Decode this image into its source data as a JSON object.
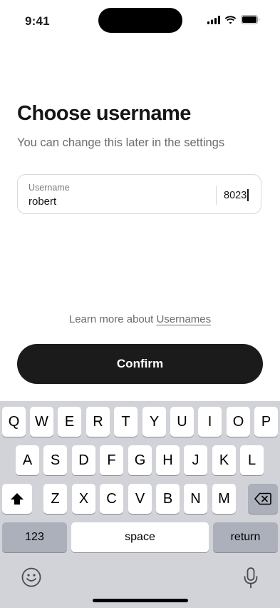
{
  "status_bar": {
    "time": "9:41",
    "icons": [
      "cellular-signal-icon",
      "wifi-icon",
      "battery-icon"
    ]
  },
  "page": {
    "title": "Choose username",
    "subtitle": "You can change this later in the settings"
  },
  "username_field": {
    "label": "Username",
    "value": "robert",
    "suffix": "8023"
  },
  "learn_more": {
    "prefix": "Learn more about ",
    "link": "Usernames"
  },
  "confirm_label": "Confirm",
  "keyboard": {
    "row1": [
      "Q",
      "W",
      "E",
      "R",
      "T",
      "Y",
      "U",
      "I",
      "O",
      "P"
    ],
    "row2": [
      "A",
      "S",
      "D",
      "F",
      "G",
      "H",
      "J",
      "K",
      "L"
    ],
    "row3": [
      "Z",
      "X",
      "C",
      "V",
      "B",
      "N",
      "M"
    ],
    "numbers_label": "123",
    "space_label": "space",
    "return_label": "return",
    "icons": [
      "shift-icon",
      "delete-icon",
      "emoji-icon",
      "microphone-icon"
    ]
  },
  "colors": {
    "primary_button": "#1b1b1b",
    "keyboard_bg": "#d1d3d9",
    "muted_text": "#6b6b70"
  }
}
